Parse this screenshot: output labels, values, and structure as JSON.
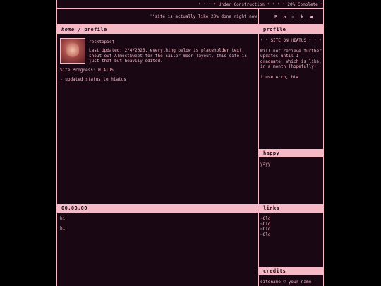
{
  "ticker": "ᵎ ᵎ ᵎ ᵎ Under Construction ᵎ ᵎ ᵎ ᵎ 20% Complete ᵎ ᵎ ᵎ ᵎ",
  "subbar": "''site is actually like 20% done right now",
  "back_label": "B a c k  ◀",
  "main_header": {
    "home": "home",
    "sep": " / ",
    "page": "profile"
  },
  "profile": {
    "username": "rocktopic†",
    "updated": "Last Updated: 2/4/2025. everything below is placeholder text. shout out AlmostSweet for the sailor moon layout. this site is just that but heavily edited.",
    "progress": "Site Progress: HIATUS",
    "status": "- updated status to hiatus"
  },
  "side1": {
    "header": "profile",
    "hiatus": "ᵎ ᵎ SITE ON HIATUS ᵎ ᵎ ᵎ",
    "note": "Will not recieve further updates until I graduate. Which is like, in a month (hopefully)",
    "arch": "i use Arch, btw"
  },
  "side2": {
    "header": "happy",
    "text": "yayy"
  },
  "bottom": {
    "header": "00.00.00",
    "line1": "hi",
    "line2": "hi"
  },
  "links": {
    "header": "links",
    "items": [
      "~Old",
      "~Old",
      "~Old",
      "~Old"
    ]
  },
  "credits": {
    "header": "credits",
    "text": "sitename © your name"
  },
  "colors": {
    "pink": "#f4b9c4",
    "panel": "#1a0714",
    "background": "#000000"
  }
}
